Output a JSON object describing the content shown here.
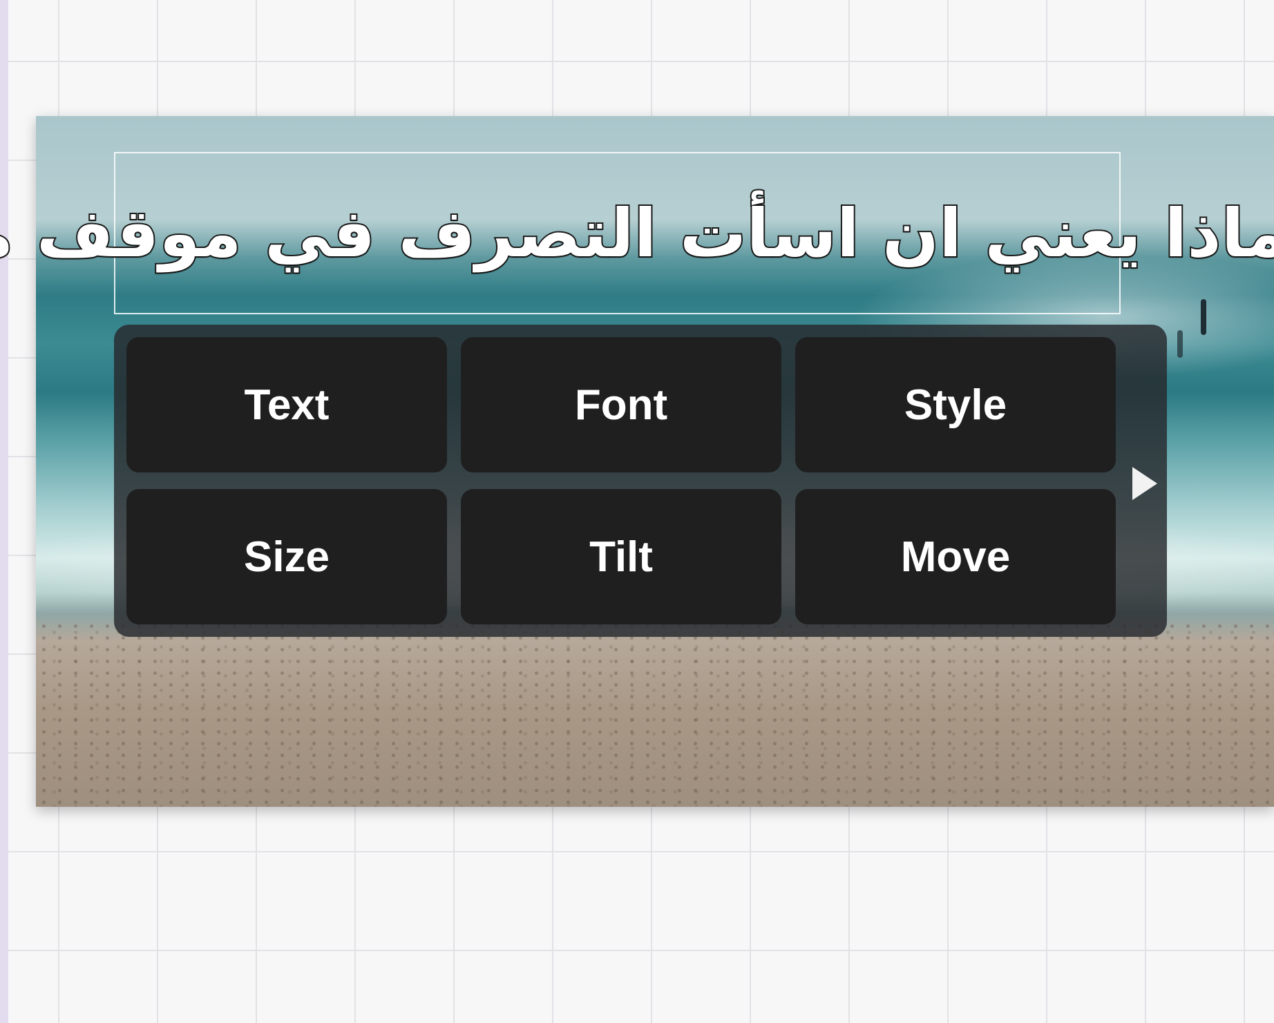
{
  "caption": {
    "text": "ماذا يعني ان اسأت التصرف في موقف ما"
  },
  "edit_menu": {
    "buttons": [
      {
        "id": "text",
        "label": "Text"
      },
      {
        "id": "font",
        "label": "Font"
      },
      {
        "id": "style",
        "label": "Style"
      },
      {
        "id": "size",
        "label": "Size"
      },
      {
        "id": "tilt",
        "label": "Tilt"
      },
      {
        "id": "move",
        "label": "Move"
      }
    ],
    "next_icon": "play-triangle-right"
  },
  "colors": {
    "canvas_background": "#f7f7f8",
    "grid_lines": "#e2e2e6",
    "menu_panel": "#26282c",
    "menu_button": "#1f1f20",
    "button_text": "#ffffff",
    "caption_fill": "#ffffff",
    "caption_outline": "#1a1a1a",
    "left_strip": "#e3dcef"
  }
}
